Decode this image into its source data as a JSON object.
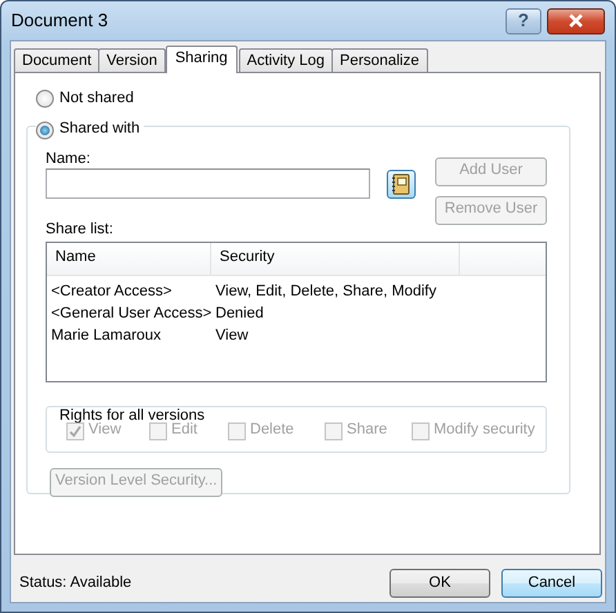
{
  "window": {
    "title": "Document 3",
    "help_button": "?"
  },
  "tabs": [
    {
      "label": "Document",
      "selected": false
    },
    {
      "label": "Version",
      "selected": false
    },
    {
      "label": "Sharing",
      "selected": true
    },
    {
      "label": "Activity Log",
      "selected": false
    },
    {
      "label": "Personalize",
      "selected": false
    }
  ],
  "sharing": {
    "options": [
      {
        "label": "Not shared",
        "selected": false
      },
      {
        "label": "Shared with",
        "selected": true
      }
    ],
    "name_label": "Name:",
    "add_user": {
      "label": "Add User",
      "disabled": true
    },
    "remove_user": {
      "label": "Remove User",
      "disabled": true
    },
    "share_list_label": "Share list:",
    "share_list": {
      "columns": [
        "Name",
        "Security"
      ],
      "rows": [
        [
          "<Creator Access>",
          "View, Edit, Delete, Share, Modify"
        ],
        [
          "<General User Access>",
          "Denied"
        ],
        [
          "Marie Lamaroux",
          "View"
        ]
      ]
    },
    "rights": {
      "title": "Rights for all versions",
      "items": [
        {
          "label": "View",
          "checked": true,
          "disabled": true
        },
        {
          "label": "Edit",
          "checked": false,
          "disabled": true
        },
        {
          "label": "Delete",
          "checked": false,
          "disabled": true
        },
        {
          "label": "Share",
          "checked": false,
          "disabled": true
        },
        {
          "label": "Modify security",
          "checked": false,
          "disabled": true
        }
      ]
    },
    "version_button": {
      "label": "Version Level Security...",
      "disabled": true
    }
  },
  "status_bar": "Status: Available",
  "buttons": [
    {
      "label": "OK",
      "focused": false
    },
    {
      "label": "Cancel",
      "focused": true
    }
  ]
}
